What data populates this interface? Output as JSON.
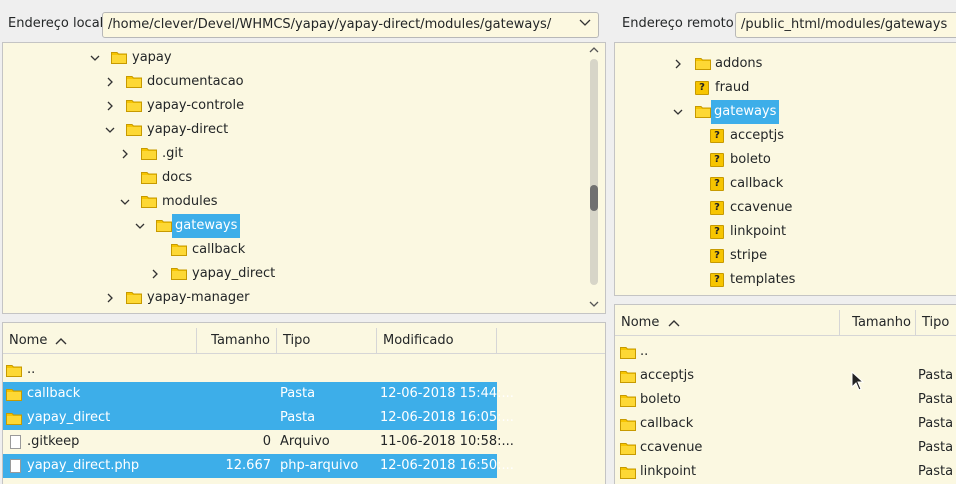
{
  "local": {
    "address_label": "Endereço local:",
    "address_value": "/home/clever/Devel/WHMCS/yapay/yapay-direct/modules/gateways/",
    "tree": [
      {
        "label": "yapay",
        "depth": 0,
        "expander": "open"
      },
      {
        "label": "documentacao",
        "depth": 1,
        "expander": "closed"
      },
      {
        "label": "yapay-controle",
        "depth": 1,
        "expander": "closed"
      },
      {
        "label": "yapay-direct",
        "depth": 1,
        "expander": "open"
      },
      {
        "label": ".git",
        "depth": 2,
        "expander": "closed"
      },
      {
        "label": "docs",
        "depth": 2,
        "expander": "none"
      },
      {
        "label": "modules",
        "depth": 2,
        "expander": "open"
      },
      {
        "label": "gateways",
        "depth": 3,
        "expander": "open",
        "selected": true
      },
      {
        "label": "callback",
        "depth": 4,
        "expander": "none"
      },
      {
        "label": "yapay_direct",
        "depth": 4,
        "expander": "closed"
      },
      {
        "label": "yapay-manager",
        "depth": 1,
        "expander": "closed"
      }
    ],
    "columns": [
      "Nome",
      "Tamanho",
      "Tipo",
      "Modificado"
    ],
    "files": [
      {
        "name": "..",
        "size": "",
        "type": "",
        "modified": "",
        "icon": "folder-icon",
        "selected": false
      },
      {
        "name": "callback",
        "size": "",
        "type": "Pasta",
        "modified": "12-06-2018 15:44:...",
        "icon": "folder-icon",
        "selected": true
      },
      {
        "name": "yapay_direct",
        "size": "",
        "type": "Pasta",
        "modified": "12-06-2018 16:05:...",
        "icon": "folder-icon",
        "selected": true
      },
      {
        "name": ".gitkeep",
        "size": "0",
        "type": "Arquivo",
        "modified": "11-06-2018 10:58:...",
        "icon": "file-icon",
        "selected": false
      },
      {
        "name": "yapay_direct.php",
        "size": "12.667",
        "type": "php-arquivo",
        "modified": "12-06-2018 16:50:...",
        "icon": "file-icon",
        "selected": true
      }
    ]
  },
  "remote": {
    "address_label": "Endereço remoto:",
    "address_value": "/public_html/modules/gateways",
    "tree": [
      {
        "label": "addons",
        "depth": 0,
        "expander": "closed",
        "icon": "folder-icon"
      },
      {
        "label": "fraud",
        "depth": 0,
        "expander": "none",
        "icon": "unknown-folder-icon"
      },
      {
        "label": "gateways",
        "depth": 0,
        "expander": "open",
        "icon": "folder-icon",
        "selected": true
      },
      {
        "label": "acceptjs",
        "depth": 1,
        "expander": "none",
        "icon": "unknown-folder-icon"
      },
      {
        "label": "boleto",
        "depth": 1,
        "expander": "none",
        "icon": "unknown-folder-icon"
      },
      {
        "label": "callback",
        "depth": 1,
        "expander": "none",
        "icon": "unknown-folder-icon"
      },
      {
        "label": "ccavenue",
        "depth": 1,
        "expander": "none",
        "icon": "unknown-folder-icon"
      },
      {
        "label": "linkpoint",
        "depth": 1,
        "expander": "none",
        "icon": "unknown-folder-icon"
      },
      {
        "label": "stripe",
        "depth": 1,
        "expander": "none",
        "icon": "unknown-folder-icon"
      },
      {
        "label": "templates",
        "depth": 1,
        "expander": "none",
        "icon": "unknown-folder-icon"
      }
    ],
    "columns": [
      "Nome",
      "Tamanho",
      "Tipo"
    ],
    "files": [
      {
        "name": "..",
        "type": ""
      },
      {
        "name": "acceptjs",
        "type": "Pasta"
      },
      {
        "name": "boleto",
        "type": "Pasta"
      },
      {
        "name": "callback",
        "type": "Pasta"
      },
      {
        "name": "ccavenue",
        "type": "Pasta"
      },
      {
        "name": "linkpoint",
        "type": "Pasta"
      }
    ]
  },
  "colors": {
    "selection": "#3daee9",
    "pane_bg": "#fbf8e1",
    "folder": "#f7c500"
  }
}
